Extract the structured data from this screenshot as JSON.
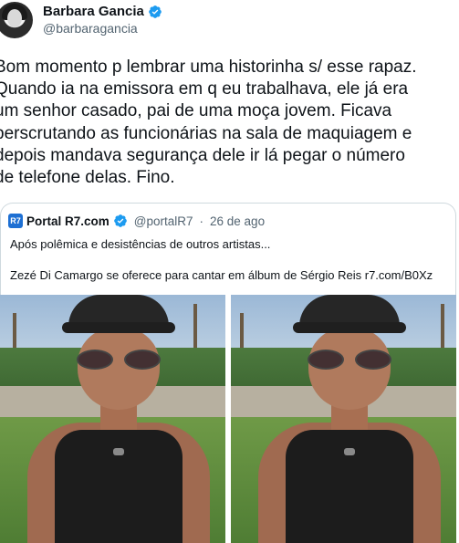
{
  "author": {
    "name": "Barbara Gancia",
    "handle": "@barbaragancia"
  },
  "tweet": {
    "text": "Bom momento p lembrar uma historinha s/ esse rapaz.\nQuando ia na emissora em q eu trabalhava, ele já era\num senhor casado, pai de uma moça jovem. Ficava\nperscrutando as funcionárias na sala de maquiagem e\ndepois mandava segurança dele ir lá pegar o número\nde telefone delas. Fino."
  },
  "quote": {
    "logo_text": "R7",
    "name": "Portal R7.com",
    "handle": "@portalR7",
    "separator": "·",
    "date": "26 de ago",
    "line1": "Após polêmica e desistências de outros artistas...",
    "line2": "Zezé Di Camargo se oferece para cantar em álbum de Sérgio Reis r7.com/B0Xz"
  },
  "colors": {
    "verified": "#1d9bf0",
    "secondary_text": "#536471",
    "border": "#cfd9de"
  },
  "icons": {
    "verified": "verified-badge-icon"
  }
}
